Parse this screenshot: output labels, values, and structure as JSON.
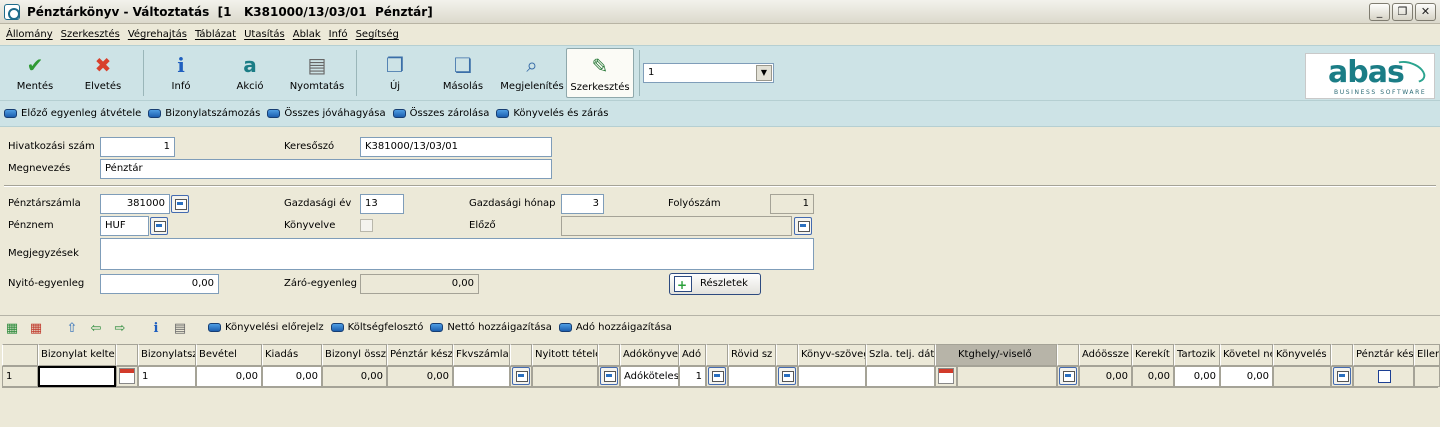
{
  "window": {
    "title": "Pénztárkönyv - Változtatás  [1   K381000/13/03/01  Pénztár]",
    "controls": [
      "_",
      "❐",
      "✕"
    ]
  },
  "menu": [
    "Állomány",
    "Szerkesztés",
    "Végrehajtás",
    "Táblázat",
    "Utasítás",
    "Ablak",
    "Infó",
    "Segítség"
  ],
  "toolbar": {
    "save": "Mentés",
    "discard": "Elvetés",
    "info": "Infó",
    "action": "Akció",
    "print": "Nyomtatás",
    "new": "Új",
    "copy": "Másolás",
    "view": "Megjelenítés",
    "edit": "Szerkesztés",
    "combo_value": "1"
  },
  "logo": {
    "word": "abas",
    "sub": "BUSINESS SOFTWARE"
  },
  "actions": [
    "Előző egyenleg átvétele",
    "Bizonylatszámozás",
    "Összes jóváhagyása",
    "Összes zárolása",
    "Könyvelés és zárás"
  ],
  "form": {
    "ref_label": "Hivatkozási szám",
    "ref_value": "1",
    "search_label": "Keresőszó",
    "search_value": "K381000/13/03/01",
    "name_label": "Megnevezés",
    "name_value": "Pénztár",
    "account_label": "Pénztárszámla",
    "account_value": "381000",
    "fiscal_year_label": "Gazdasági év",
    "fiscal_year_value": "13",
    "fiscal_month_label": "Gazdasági hónap",
    "fiscal_month_value": "3",
    "serial_label": "Folyószám",
    "serial_value": "1",
    "currency_label": "Pénznem",
    "currency_value": "HUF",
    "posted_label": "Könyvelve",
    "previous_label": "Előző",
    "previous_value": "",
    "notes_label": "Megjegyzések",
    "notes_value": "",
    "opening_label": "Nyitó-egyenleg",
    "opening_value": "0,00",
    "closing_label": "Záró-egyenleg",
    "closing_value": "0,00",
    "details_button": "Részletek"
  },
  "grid_actions": [
    "Könyvelési előrejelz",
    "Költségfelosztó",
    "Nettó hozzáigazítása",
    "Adó hozzáigazítása"
  ],
  "grid": {
    "headers": [
      "Bizonylat kelte",
      "Bizonylatsz",
      "Bevétel",
      "Kiadás",
      "Bizonyl össz",
      "Pénztár kész",
      "Fkvszámla",
      "Nyitott tétele",
      "Adókönyve",
      "Adó",
      "Rövid sz",
      "Könyv-szöveg",
      "Szla. telj. dát",
      "Ktghely/-viselő",
      "Adóössze",
      "Kerekít",
      "Tartozik",
      "Követel ne",
      "Könyvelés",
      "Pénztár kés",
      "Eller"
    ],
    "row": {
      "num": "1",
      "doc_date": "",
      "doc_no": "1",
      "income": "0,00",
      "expense": "0,00",
      "doc_total": "0,00",
      "cash": "0,00",
      "tax_book": "Adóköteles",
      "tax": "1",
      "tax_amount": "0,00",
      "rounding": "0,00",
      "debit": "0,00",
      "credit": "0,00"
    }
  }
}
